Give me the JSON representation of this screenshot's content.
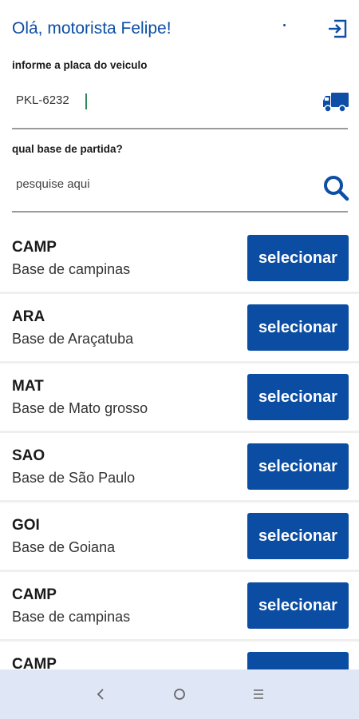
{
  "header": {
    "greeting": "Olá, motorista Felipe!"
  },
  "plate": {
    "label": "informe a placa do veiculo",
    "value": "PKL-6232"
  },
  "base_search": {
    "label": "qual base de partida?",
    "placeholder": "pesquise aqui"
  },
  "bases": [
    {
      "code": "CAMP",
      "name": "Base de campinas",
      "button": "selecionar"
    },
    {
      "code": "ARA",
      "name": "Base de Araçatuba",
      "button": "selecionar"
    },
    {
      "code": "MAT",
      "name": "Base de Mato grosso",
      "button": "selecionar"
    },
    {
      "code": "SAO",
      "name": "Base de São Paulo",
      "button": "selecionar"
    },
    {
      "code": "GOI",
      "name": "Base de Goiana",
      "button": "selecionar"
    },
    {
      "code": "CAMP",
      "name": "Base de campinas",
      "button": "selecionar"
    },
    {
      "code": "CAMP",
      "name": "",
      "button": ""
    }
  ],
  "icons": {
    "logout": "logout-icon",
    "truck": "truck-icon",
    "search": "search-icon",
    "nav_back": "back-icon",
    "nav_home": "home-icon",
    "nav_recents": "recents-icon"
  },
  "colors": {
    "primary": "#0b4da2",
    "navbar": "#dfe6f6"
  }
}
